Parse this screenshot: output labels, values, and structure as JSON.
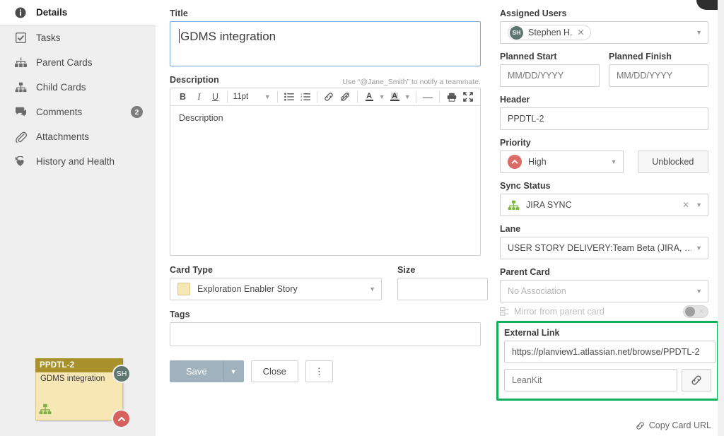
{
  "sidebar": {
    "items": [
      {
        "label": "Details",
        "icon": "info-icon",
        "active": true,
        "badge": ""
      },
      {
        "label": "Tasks",
        "icon": "checkbox-icon",
        "active": false,
        "badge": ""
      },
      {
        "label": "Parent Cards",
        "icon": "parent-cards-icon",
        "active": false,
        "badge": ""
      },
      {
        "label": "Child Cards",
        "icon": "child-cards-icon",
        "active": false,
        "badge": ""
      },
      {
        "label": "Comments",
        "icon": "comment-icon",
        "active": false,
        "badge": "2"
      },
      {
        "label": "Attachments",
        "icon": "paperclip-icon",
        "active": false,
        "badge": ""
      },
      {
        "label": "History and Health",
        "icon": "history-heart-icon",
        "active": false,
        "badge": ""
      }
    ]
  },
  "mini_card": {
    "header": "PPDTL-2",
    "title": "GDMS integration",
    "avatar_initials": "SH",
    "header_color": "#a8912c",
    "body_color": "#f7e7b4",
    "priority_color": "#d6625f",
    "sync_icon": "jira-sync-icon"
  },
  "main": {
    "title_label": "Title",
    "title_value": "GDMS integration",
    "description_label": "Description",
    "description_hint": "Use “@Jane_Smith” to notify a teammate.",
    "description_value": "Description",
    "toolbar": {
      "bold": "B",
      "italic": "I",
      "underline": "U",
      "font_size": "11pt",
      "bullet_list": "bullet-list-icon",
      "numbered_list": "numbered-list-icon",
      "insert_link": "link-icon",
      "remove_link": "unlink-icon",
      "text_color": "A",
      "highlight_color": "A",
      "horizontal_rule": "—",
      "print": "printer-icon",
      "fullscreen": "fullscreen-icon"
    },
    "card_type_label": "Card Type",
    "card_type_value": "Exploration Enabler Story",
    "card_type_swatch": "#f7e7b4",
    "size_label": "Size",
    "size_value": "",
    "tags_label": "Tags",
    "tags_value": "",
    "save_label": "Save",
    "close_label": "Close",
    "more_label": "⋮"
  },
  "right": {
    "assigned_users_label": "Assigned Users",
    "assigned_users": [
      {
        "initials": "SH",
        "name": "Stephen H."
      }
    ],
    "planned_start_label": "Planned Start",
    "planned_start_placeholder": "MM/DD/YYYY",
    "planned_start_value": "",
    "planned_finish_label": "Planned Finish",
    "planned_finish_placeholder": "MM/DD/YYYY",
    "planned_finish_value": "",
    "header_label": "Header",
    "header_value": "PPDTL-2",
    "priority_label": "Priority",
    "priority_value": "High",
    "priority_color": "#dd6b66",
    "blocked_label": "Unblocked",
    "sync_status_label": "Sync Status",
    "sync_status_value": "JIRA SYNC",
    "sync_icon_color": "#7cb342",
    "lane_label": "Lane",
    "lane_value": "USER STORY DELIVERY:Team Beta (JIRA, …",
    "parent_card_label": "Parent Card",
    "parent_card_value": "No Association",
    "mirror_label": "Mirror from parent card",
    "mirror_on": false,
    "external_link_label": "External Link",
    "external_link_url": "https://planview1.atlassian.net/browse/PPDTL-2",
    "external_link_name_placeholder": "LeanKit",
    "external_link_name_value": "",
    "external_link_highlight_color": "#12b05c",
    "copy_card_url_label": "Copy Card URL"
  }
}
